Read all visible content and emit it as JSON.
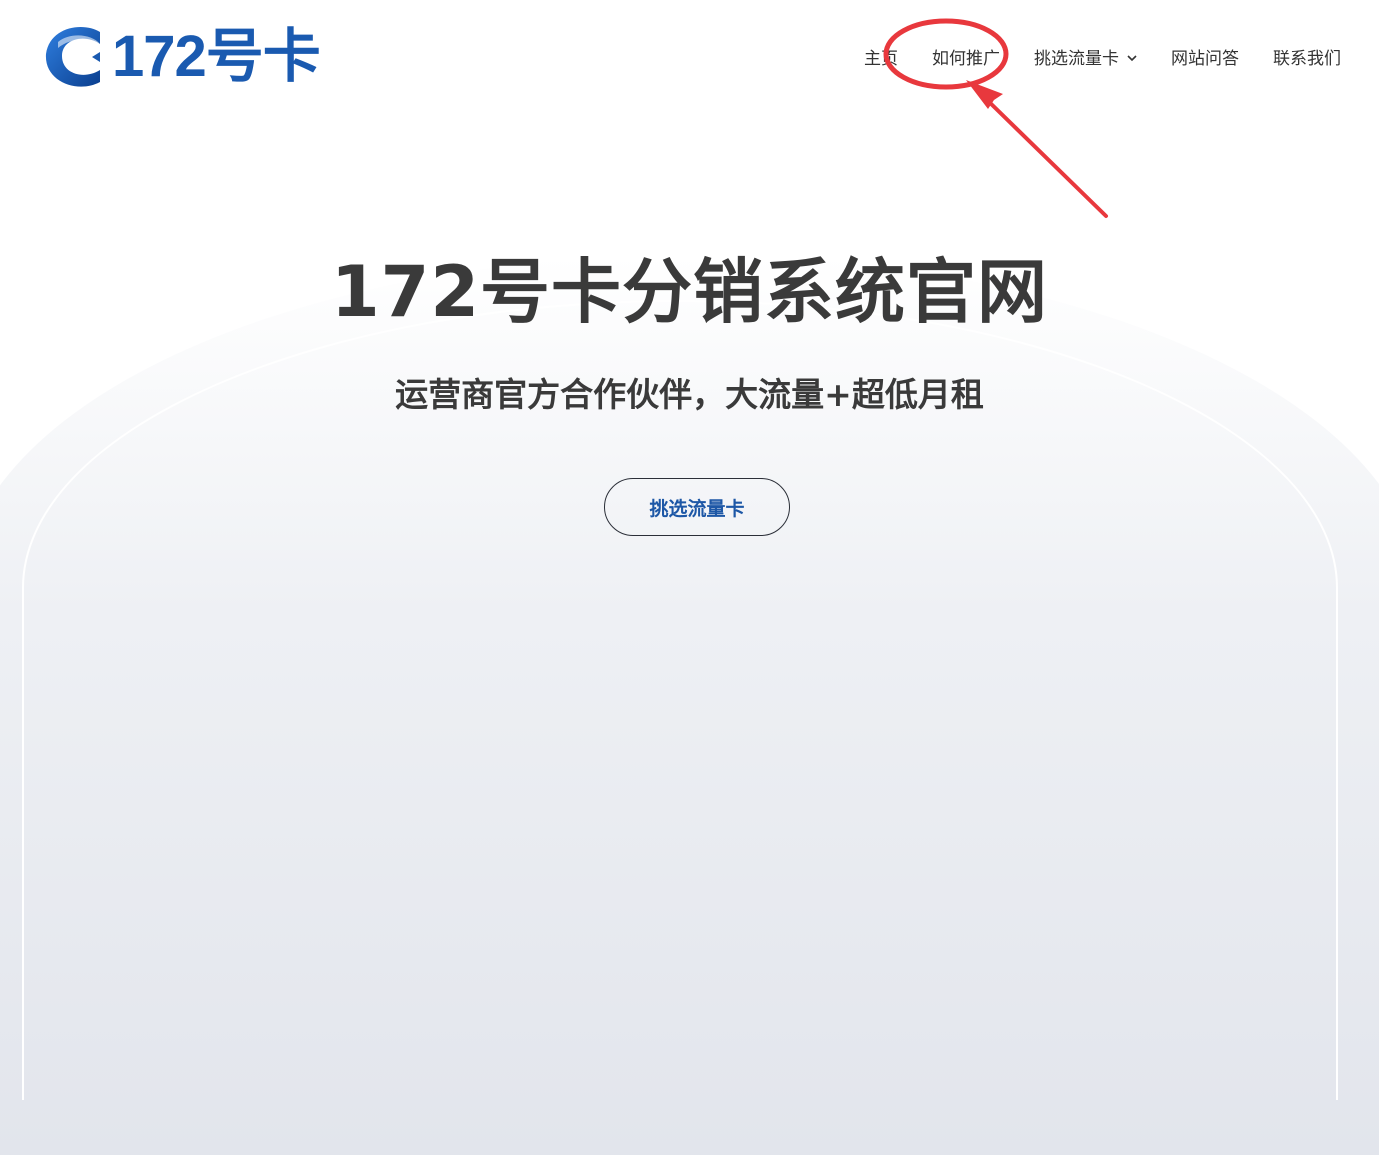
{
  "logo": {
    "text": "172号卡",
    "icon": "172-logo-icon",
    "color": "#1a5ab0"
  },
  "nav": {
    "items": [
      {
        "label": "主页"
      },
      {
        "label": "如何推广"
      },
      {
        "label": "挑选流量卡",
        "dropdown": true
      },
      {
        "label": "网站问答"
      },
      {
        "label": "联系我们"
      }
    ]
  },
  "hero": {
    "title": "172号卡分销系统官网",
    "subtitle": "运营商官方合作伙伴，大流量+超低月租",
    "cta_label": "挑选流量卡"
  },
  "annotation": {
    "color": "#e8383d",
    "highlight": "如何推广"
  }
}
